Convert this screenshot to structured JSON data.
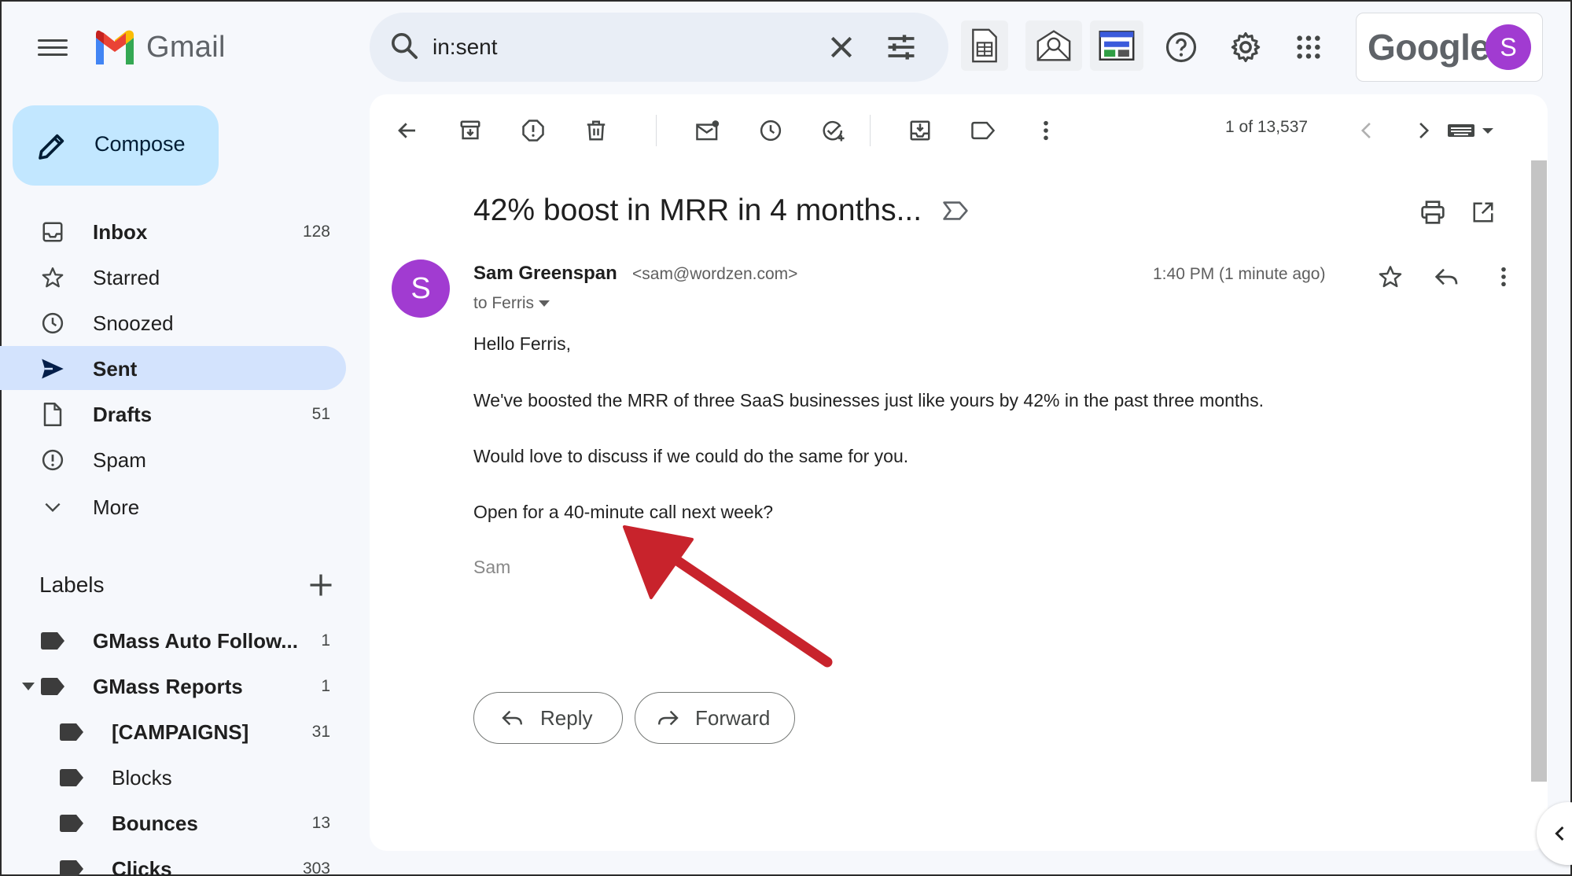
{
  "app": {
    "name": "Gmail",
    "account_brand": "Google",
    "avatar_letter": "S"
  },
  "search": {
    "query": "in:sent"
  },
  "compose": {
    "label": "Compose"
  },
  "nav": [
    {
      "label": "Inbox",
      "count": "128",
      "icon": "inbox-icon"
    },
    {
      "label": "Starred",
      "count": "",
      "icon": "star-icon"
    },
    {
      "label": "Snoozed",
      "count": "",
      "icon": "clock-icon"
    },
    {
      "label": "Sent",
      "count": "",
      "icon": "send-icon"
    },
    {
      "label": "Drafts",
      "count": "51",
      "icon": "draft-icon"
    },
    {
      "label": "Spam",
      "count": "",
      "icon": "spam-icon"
    },
    {
      "label": "More",
      "count": "",
      "icon": "chevron-down-icon"
    }
  ],
  "labels": {
    "title": "Labels",
    "items": [
      {
        "label": "GMass Auto Follow...",
        "count": "1"
      },
      {
        "label": "GMass Reports",
        "count": "1"
      },
      {
        "label": "[CAMPAIGNS]",
        "count": "31"
      },
      {
        "label": "Blocks",
        "count": ""
      },
      {
        "label": "Bounces",
        "count": "13"
      },
      {
        "label": "Clicks",
        "count": "303"
      }
    ]
  },
  "toolbar": {
    "pager": "1 of 13,537"
  },
  "message": {
    "subject": "42% boost in MRR in 4 months...",
    "avatar_letter": "S",
    "sender_name": "Sam Greenspan",
    "sender_email": "<sam@wordzen.com>",
    "to": "to Ferris",
    "time": "1:40 PM (1 minute ago)",
    "body": [
      "Hello Ferris,",
      "We've boosted the MRR of three SaaS businesses just like yours by 42% in the past three months.",
      "Would love to discuss if we could do the same for you.",
      "Open for a 40-minute call next week?"
    ],
    "signature": "Sam"
  },
  "actions": {
    "reply": "Reply",
    "forward": "Forward"
  },
  "colors": {
    "accent": "#c2e7ff",
    "active_nav": "#d3e3fd",
    "avatar": "#a13bd1",
    "annotation_arrow": "#c8232c"
  }
}
